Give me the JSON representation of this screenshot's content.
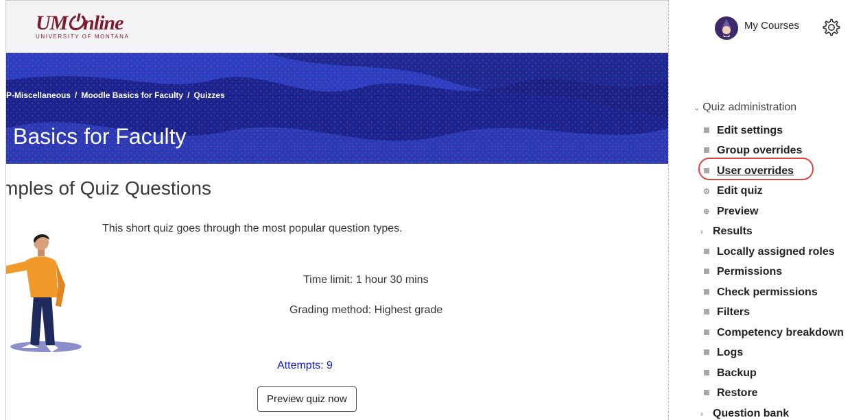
{
  "logo": {
    "text": "UM⏻nline",
    "subtitle": "UNIVERSITY OF MONTANA"
  },
  "breadcrumb": [
    "P-Miscellaneous",
    "Moodle Basics for Faculty",
    "Quizzes"
  ],
  "course_title": "Basics for Faculty",
  "quiz": {
    "title": "mples of Quiz Questions",
    "intro": "This short quiz goes through the most popular question types.",
    "time_limit": "Time limit: 1 hour 30 mins",
    "grading_method": "Grading method: Highest grade",
    "attempts": "Attempts: 9",
    "preview_button": "Preview quiz now"
  },
  "user_menu": {
    "my_courses": "My Courses",
    "avatar_icon": "wizard-avatar-icon",
    "settings_icon": "gear-icon"
  },
  "admin": {
    "heading": "Quiz administration",
    "items": [
      {
        "label": "Edit settings",
        "icon": "bullet"
      },
      {
        "label": "Group overrides",
        "icon": "bullet"
      },
      {
        "label": "User overrides",
        "icon": "bullet",
        "highlighted": true
      },
      {
        "label": "Edit quiz",
        "icon": "gear-icon"
      },
      {
        "label": "Preview",
        "icon": "zoom-icon"
      },
      {
        "label": "Results",
        "icon": "chevron-right-icon"
      },
      {
        "label": "Locally assigned roles",
        "icon": "bullet"
      },
      {
        "label": "Permissions",
        "icon": "bullet"
      },
      {
        "label": "Check permissions",
        "icon": "bullet"
      },
      {
        "label": "Filters",
        "icon": "bullet"
      },
      {
        "label": "Competency breakdown",
        "icon": "bullet"
      },
      {
        "label": "Logs",
        "icon": "bullet"
      },
      {
        "label": "Backup",
        "icon": "bullet"
      },
      {
        "label": "Restore",
        "icon": "bullet"
      },
      {
        "label": "Question bank",
        "icon": "chevron-right-icon"
      }
    ]
  },
  "colors": {
    "brand": "#7a1c2b",
    "link": "#0f1ed6",
    "highlight_ring": "#e0453c",
    "banner": "#1e2a9c"
  }
}
